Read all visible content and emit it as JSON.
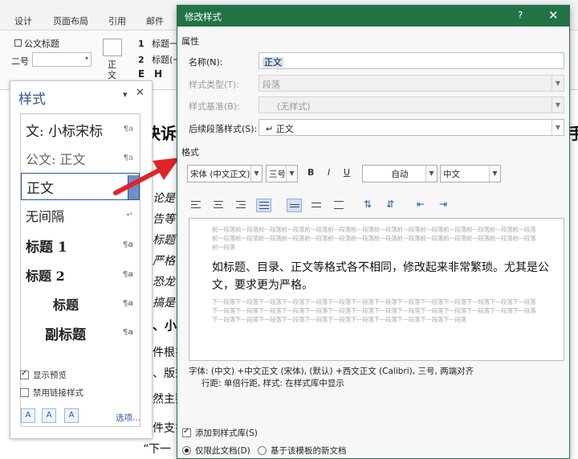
{
  "ribbon": {
    "tabs": [
      "设计",
      "页面布局",
      "引用",
      "邮件"
    ],
    "style_gallery_left": "公文标题",
    "font_size_label": "二号",
    "gallery_zhengwen": "正\n文",
    "gallery_items": [
      {
        "num": "1",
        "label": "标题一"
      },
      {
        "num": "2",
        "label": "标题(一"
      }
    ],
    "gallery_letters": [
      "E",
      "H"
    ]
  },
  "document": {
    "heading_fragment": "快诉",
    "right_fragment": "手",
    "lines": [
      "论是",
      "告等",
      "标题",
      "严格",
      "恐龙",
      "搞是",
      "、小",
      "件根扌",
      "、版式",
      "然主要",
      "件支扌",
      "“下一"
    ]
  },
  "styles_pane": {
    "title": "样式",
    "pin_icon": "pin-icon",
    "close_icon": "close-icon",
    "items": [
      {
        "label": "文: 小标宋标",
        "mark": "¶a"
      },
      {
        "label": "公文: 正文",
        "mark": "¶a"
      },
      {
        "label": "正文",
        "mark": "",
        "selected": true
      },
      {
        "label": "无间隔",
        "mark": "↵"
      },
      {
        "label": "标题 1",
        "mark": "¶a"
      },
      {
        "label": "标题 2",
        "mark": "¶a"
      },
      {
        "label": "标题",
        "mark": "¶a"
      },
      {
        "label": "副标题",
        "mark": "¶a"
      }
    ],
    "show_preview": "显示预览",
    "disable_linked": "禁用链接样式",
    "options_link": "选项..."
  },
  "dialog": {
    "title": "修改样式",
    "help": "?",
    "close": "✕",
    "section_properties": "属性",
    "name_label": "名称(N):",
    "name_value": "正文",
    "type_label": "样式类型(T):",
    "type_value": "段落",
    "based_label": "样式基准(B):",
    "based_value": "(无样式)",
    "next_label": "后续段落样式(S):",
    "next_value": "↵ 正文",
    "section_format": "格式",
    "font_name": "宋体 (中文正文)",
    "font_size": "三号",
    "bold": "B",
    "italic": "I",
    "underline": "U",
    "color": "自动",
    "script": "中文",
    "preview_prev": "前一段落前一段落前一段落前一段落前一段落前一段落前一段落前一段落前一段落前一段落前一段落前一段落前一段落前一段落前一段落前一段落前一段落前一段落前一段落前一段落前一段落前一段落前一段落前一段落前一段落前一段落前一段落前一段落前一段落",
    "preview_text": "如标题、目录、正文等格式各不相同，修改起来非常繁琐。尤其是公文，要求更为严格。",
    "preview_next": "下一段落下一段落下一段落下一段落下一段落下一段落下一段落下一段落下一段落下一段落下一段落下一段落下一段落下一段落下一段落下一段落下一段落下一段落下一段落下一段落下一段落下一段落下一段落下一段落下一段落下一段落下一段落下一段落下一段落下一段落下一段落下一段落下一段落下一段落下一段落下一段落下一段落下一段落下一段落",
    "description_line1": "字体: (中文) +中文正文 (宋体), (默认) +西文正文 (Calibri), 三号, 两端对齐",
    "description_line2": "行距: 单倍行距, 样式: 在样式库中显示",
    "add_to_gallery": "添加到样式库(S)",
    "only_this_doc": "仅限此文档(D)",
    "new_docs": "基于该模板的新文档"
  },
  "colors": {
    "dialog_title": "#217346",
    "accent": "#2b579a",
    "arrow": "#e0242a"
  }
}
